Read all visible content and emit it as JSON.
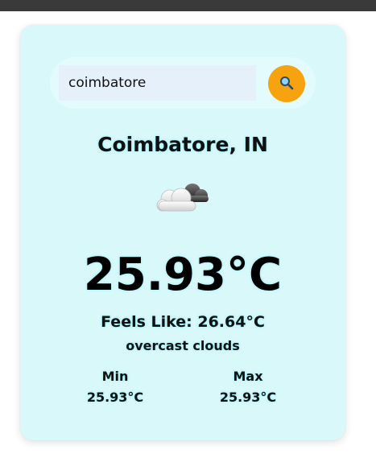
{
  "search": {
    "value": "coimbatore",
    "button_icon": "search-icon"
  },
  "weather": {
    "location": "Coimbatore, IN",
    "icon": "overcast-clouds-icon",
    "temperature": "25.93°C",
    "feels_like": "Feels Like: 26.64°C",
    "description": "overcast clouds",
    "min_label": "Min",
    "min_value": "25.93°C",
    "max_label": "Max",
    "max_value": "25.93°C"
  },
  "colors": {
    "card_background": "#d9f8fa",
    "search_button": "#f7a30f",
    "top_bar": "#3a3a3a"
  }
}
